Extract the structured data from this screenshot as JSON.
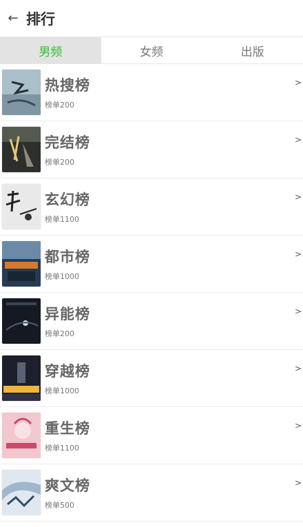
{
  "header": {
    "title": "排行",
    "back_icon": "arrow-left-icon"
  },
  "tabs": [
    {
      "label": "男频",
      "active": true
    },
    {
      "label": "女频",
      "active": false
    },
    {
      "label": "出版",
      "active": false
    }
  ],
  "accent_color": "#2bc52b",
  "rankings": [
    {
      "name": "热搜榜",
      "count": "榜单200",
      "cover_bg": "#a9bfc9",
      "cover_fg": "#3c4b56"
    },
    {
      "name": "完结榜",
      "count": "榜单200",
      "cover_bg": "#2d2f2c",
      "cover_fg": "#e6c77a"
    },
    {
      "name": "玄幻榜",
      "count": "榜单1100",
      "cover_bg": "#e9e9e9",
      "cover_fg": "#222222"
    },
    {
      "name": "都市榜",
      "count": "榜单1000",
      "cover_bg": "#263a54",
      "cover_fg": "#d67a2a"
    },
    {
      "name": "异能榜",
      "count": "榜单200",
      "cover_bg": "#151a22",
      "cover_fg": "#cfd8e8"
    },
    {
      "name": "穿越榜",
      "count": "榜单1000",
      "cover_bg": "#1d1f2c",
      "cover_fg": "#f2b43a"
    },
    {
      "name": "重生榜",
      "count": "榜单1100",
      "cover_bg": "#f3c7cf",
      "cover_fg": "#c94b6a"
    },
    {
      "name": "爽文榜",
      "count": "榜单500",
      "cover_bg": "#dfe7ef",
      "cover_fg": "#2d4a6a"
    }
  ],
  "row_arrow": ">"
}
